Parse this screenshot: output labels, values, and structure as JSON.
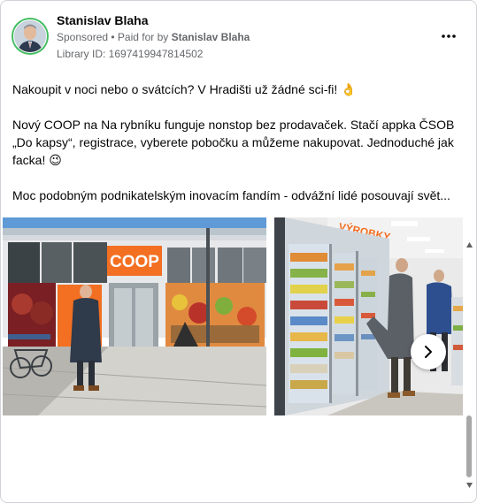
{
  "post": {
    "author": "Stanislav Blaha",
    "sponsored_label": "Sponsored",
    "paid_for_prefix": " • Paid for by ",
    "paid_for_name": "Stanislav Blaha",
    "library_id": "Library ID: 1697419947814502",
    "more_options_icon": "more-horizontal-icon"
  },
  "body": {
    "line1": "Nakoupit v noci nebo o svátcích? V Hradišti už žádné sci-fi! 👌",
    "line2": "Nový COOP na Na rybníku funguje nonstop bez prodavaček. Stačí appka ČSOB „Do kapsy“, registrace, vyberete pobočku a můžeme nakupovat. Jednoduché jak facka! 😉",
    "line3": "Moc podobným podnikatelským inovacím fandím - odvážní lidé posouvají svět..."
  },
  "media": {
    "photo1_store_sign": "COOP",
    "photo2_shelf_sign": "VÝROBKY",
    "next_icon": "chevron-right-icon"
  },
  "colors": {
    "coop_orange": "#f36f21",
    "avatar_ring": "#45bd62",
    "sky": "#5f9ad6"
  }
}
